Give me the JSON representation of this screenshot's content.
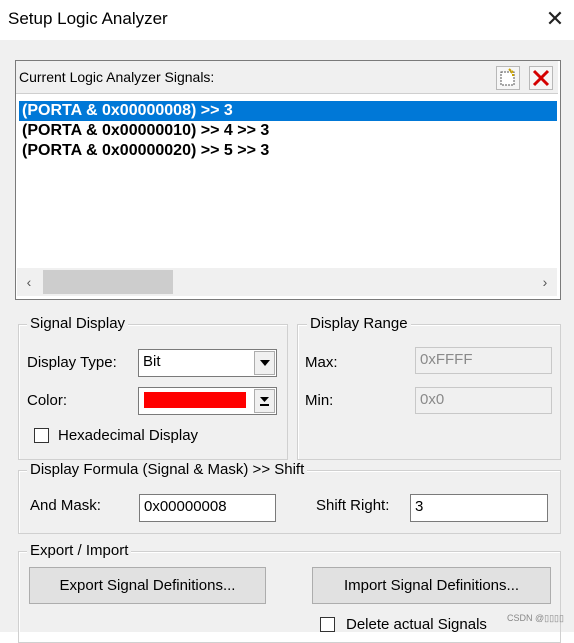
{
  "window": {
    "title": "Setup Logic Analyzer",
    "close_glyph": "✕"
  },
  "signals": {
    "label": "Current Logic Analyzer Signals:",
    "new_icon": "new-signal-icon",
    "delete_icon": "delete-signal-icon",
    "items": [
      {
        "text": "(PORTA & 0x00000008) >> 3",
        "selected": true
      },
      {
        "text": "(PORTA & 0x00000010) >> 4 >> 3",
        "selected": false
      },
      {
        "text": "(PORTA & 0x00000020) >> 5 >> 3",
        "selected": false
      }
    ],
    "scroll_left": "‹",
    "scroll_right": "›"
  },
  "signal_display": {
    "group_label": "Signal Display",
    "display_type_label": "Display Type:",
    "display_type_value": "Bit",
    "color_label": "Color:",
    "color_value": "#ff0000",
    "hex_label": "Hexadecimal Display",
    "hex_checked": false
  },
  "display_range": {
    "group_label": "Display Range",
    "max_label": "Max:",
    "max_value": "0xFFFF",
    "min_label": "Min:",
    "min_value": "0x0"
  },
  "formula": {
    "group_label": "Display Formula (Signal & Mask) >> Shift",
    "and_mask_label": "And Mask:",
    "and_mask_value": "0x00000008",
    "shift_right_label": "Shift Right:",
    "shift_right_value": "3"
  },
  "export_import": {
    "group_label": "Export / Import",
    "export_button": "Export Signal Definitions...",
    "import_button": "Import Signal Definitions...",
    "delete_label": "Delete actual Signals",
    "delete_checked": false
  },
  "watermark": "CSDN @▯▯▯▯"
}
